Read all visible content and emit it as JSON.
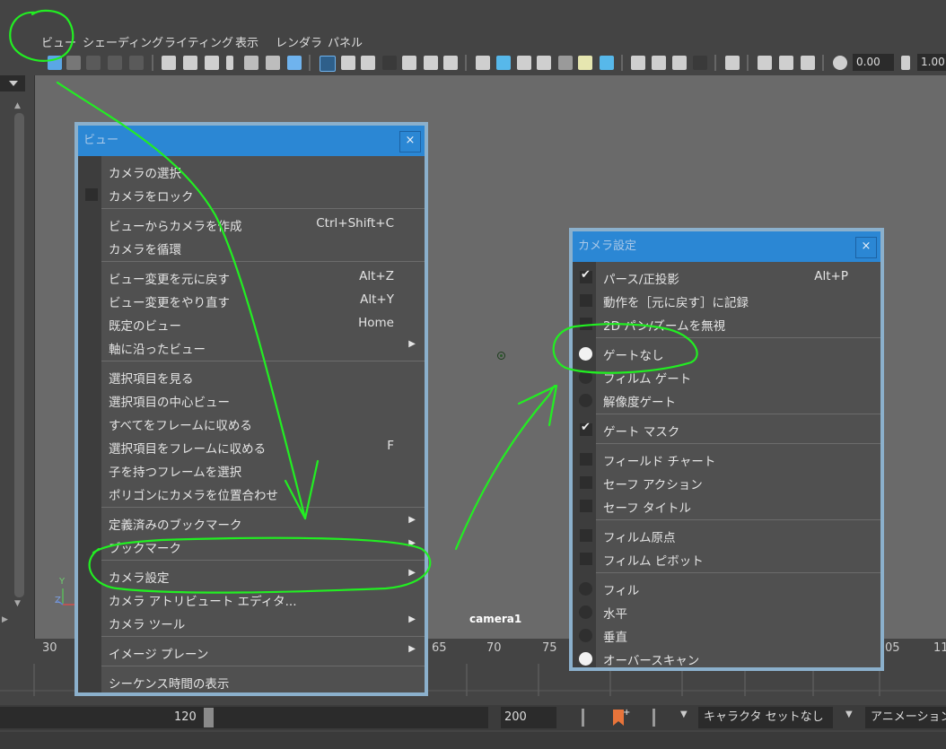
{
  "menubar": {
    "items": [
      "ビュー",
      "シェーディング",
      "ライティング",
      "表示",
      "レンダラ",
      "パネル"
    ]
  },
  "toolbar": {
    "field_1": "0.00",
    "field_2": "1.00"
  },
  "viewport": {
    "camera_label": "camera1",
    "axis_y": "Y",
    "axis_z": "Z"
  },
  "view_menu": {
    "title": "ビュー",
    "close": "×",
    "items": [
      {
        "label": "カメラの選択"
      },
      {
        "label": "カメラをロック",
        "check": false
      },
      {
        "label": "ビューからカメラを作成",
        "shortcut": "Ctrl+Shift+C"
      },
      {
        "label": "カメラを循環"
      },
      {
        "label": "ビュー変更を元に戻す",
        "shortcut": "Alt+Z"
      },
      {
        "label": "ビュー変更をやり直す",
        "shortcut": "Alt+Y"
      },
      {
        "label": "既定のビュー",
        "shortcut": "Home"
      },
      {
        "label": "軸に沿ったビュー",
        "submenu": "▶"
      },
      {
        "label": "選択項目を見る"
      },
      {
        "label": "選択項目の中心ビュー"
      },
      {
        "label": "すべてをフレームに収める"
      },
      {
        "label": "選択項目をフレームに収める",
        "shortcut": "F"
      },
      {
        "label": "子を持つフレームを選択"
      },
      {
        "label": "ポリゴンにカメラを位置合わせ"
      },
      {
        "label": "定義済みのブックマーク",
        "submenu": "▶"
      },
      {
        "label": "ブックマーク",
        "submenu": "▶"
      },
      {
        "label": "カメラ設定",
        "submenu": "▶"
      },
      {
        "label": "カメラ アトリビュート エディタ..."
      },
      {
        "label": "カメラ ツール",
        "submenu": "▶"
      },
      {
        "label": "イメージ プレーン",
        "submenu": "▶"
      },
      {
        "label": "シーケンス時間の表示"
      }
    ]
  },
  "camera_settings": {
    "title": "カメラ設定",
    "close": "×",
    "items": [
      {
        "label": "パース/正投影",
        "shortcut": "Alt+P",
        "check": true
      },
      {
        "label": "動作を［元に戻す］に記録",
        "check": false
      },
      {
        "label": "2D パン/ズームを無視",
        "check": false
      },
      {
        "label": "ゲートなし",
        "radio": true
      },
      {
        "label": "フィルム ゲート",
        "radio": false
      },
      {
        "label": "解像度ゲート",
        "radio": false
      },
      {
        "label": "ゲート マスク",
        "check": true
      },
      {
        "label": "フィールド チャート",
        "check": false
      },
      {
        "label": "セーフ アクション",
        "check": false
      },
      {
        "label": "セーフ タイトル",
        "check": false
      },
      {
        "label": "フィルム原点",
        "check": false
      },
      {
        "label": "フィルム ピボット",
        "check": false
      },
      {
        "label": "フィル",
        "radio": false
      },
      {
        "label": "水平",
        "radio": false
      },
      {
        "label": "垂直",
        "radio": false
      },
      {
        "label": "オーバースキャン",
        "radio": true
      }
    ]
  },
  "timeline": {
    "frames": [
      "30",
      "65",
      "70",
      "75",
      "05",
      "11"
    ]
  },
  "range": {
    "current": "120",
    "end": "200",
    "character_set": "キャラクタ セットなし",
    "anim_layer": "アニメーション"
  },
  "colors": {
    "accent_blue": "#2b87d4",
    "annotation_green": "#22ee22"
  }
}
